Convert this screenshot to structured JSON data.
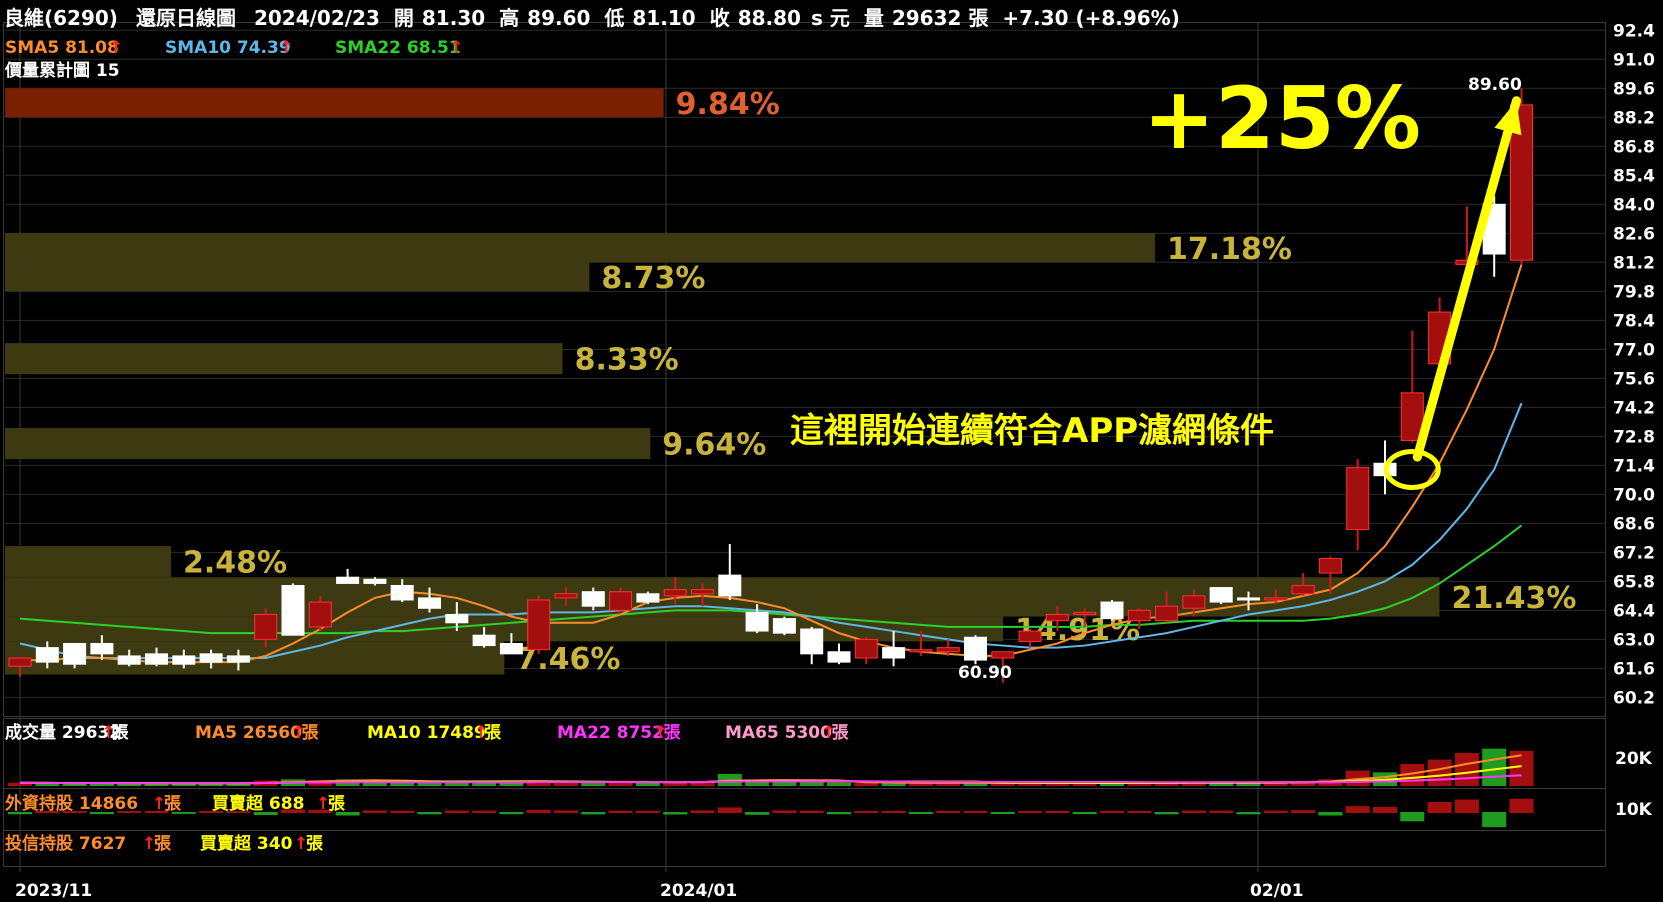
{
  "header": {
    "stock": "良維(6290)",
    "chart_kind": "還原日線圖",
    "date": "2024/02/23",
    "open_label": "開",
    "open": "81.30",
    "high_label": "高",
    "high": "89.60",
    "low_label": "低",
    "low": "81.10",
    "close_label": "收",
    "close": "88.80",
    "close_suffix": "s 元",
    "volume_label": "量",
    "volume": "29632 張",
    "change": "+7.30 (+8.96%)"
  },
  "ma_legend": [
    {
      "label": "SMA5 81.08",
      "color": "#ff8c2a"
    },
    {
      "label": "SMA10 74.39",
      "color": "#5fb6e8"
    },
    {
      "label": "SMA22 68.51",
      "color": "#2bd12b"
    }
  ],
  "vp_label": "價量累計圖 15",
  "annotation": {
    "big": "+25%",
    "text": "這裡開始連續符合APP濾網條件"
  },
  "high_marker": "89.60",
  "low_marker": "60.90",
  "volume_legend": [
    {
      "label": "成交量 29632",
      "color": "#ffffff",
      "unit": "張"
    },
    {
      "label": "MA5 26560",
      "color": "#ff8c2a",
      "unit": "張"
    },
    {
      "label": "MA10 17489",
      "color": "#ffff00",
      "unit": "張"
    },
    {
      "label": "MA22 8752",
      "color": "#ff33ff",
      "unit": "張"
    },
    {
      "label": "MA65 5300",
      "color": "#ff99cc",
      "unit": "張"
    }
  ],
  "volume_axis": [
    "20K",
    "10K"
  ],
  "foreign_legend": {
    "label": "外資持股 14866",
    "unit": "張",
    "label2": "買賣超 688",
    "unit2": "張"
  },
  "trust_legend": {
    "label": "投信持股 7627",
    "unit": "張",
    "label2": "買賣超 340",
    "unit2": "張"
  },
  "x_labels": [
    "2023/11",
    "2024/01",
    "02/01"
  ],
  "colors": {
    "up": "#a30f0f",
    "down": "#ffffff",
    "vp_top": "#7a2000",
    "vp": "#3d3a12",
    "grid": "#2b2b2b",
    "arrow": "#ffff00"
  },
  "chart_data": {
    "type": "candlestick",
    "y_ticks": [
      92.4,
      91.0,
      89.6,
      88.2,
      86.8,
      85.4,
      84.0,
      82.6,
      81.2,
      79.8,
      78.4,
      77.0,
      75.6,
      74.2,
      72.8,
      71.4,
      70.0,
      68.6,
      67.2,
      65.8,
      64.4,
      63.0,
      61.6,
      60.2
    ],
    "ylim": [
      59.3,
      92.8
    ],
    "candles": [
      {
        "o": 61.7,
        "h": 62.1,
        "l": 61.2,
        "c": 62.1
      },
      {
        "o": 62.6,
        "h": 62.9,
        "l": 61.6,
        "c": 61.9
      },
      {
        "o": 62.8,
        "h": 62.8,
        "l": 61.6,
        "c": 61.8
      },
      {
        "o": 62.8,
        "h": 63.2,
        "l": 62.0,
        "c": 62.3
      },
      {
        "o": 62.2,
        "h": 62.5,
        "l": 61.7,
        "c": 61.8
      },
      {
        "o": 62.3,
        "h": 62.6,
        "l": 61.7,
        "c": 61.8
      },
      {
        "o": 62.2,
        "h": 62.5,
        "l": 61.6,
        "c": 61.8
      },
      {
        "o": 62.3,
        "h": 62.5,
        "l": 61.6,
        "c": 61.9
      },
      {
        "o": 62.2,
        "h": 62.5,
        "l": 61.5,
        "c": 61.9
      },
      {
        "o": 63.0,
        "h": 64.5,
        "l": 62.6,
        "c": 64.2
      },
      {
        "o": 65.6,
        "h": 65.7,
        "l": 63.2,
        "c": 63.2
      },
      {
        "o": 63.6,
        "h": 65.1,
        "l": 63.4,
        "c": 64.8
      },
      {
        "o": 66.0,
        "h": 66.4,
        "l": 65.7,
        "c": 65.7
      },
      {
        "o": 65.9,
        "h": 66.0,
        "l": 65.6,
        "c": 65.7
      },
      {
        "o": 65.6,
        "h": 65.9,
        "l": 64.8,
        "c": 64.9
      },
      {
        "o": 65.0,
        "h": 65.5,
        "l": 64.3,
        "c": 64.5
      },
      {
        "o": 64.2,
        "h": 64.8,
        "l": 63.4,
        "c": 63.8
      },
      {
        "o": 63.2,
        "h": 63.6,
        "l": 62.6,
        "c": 62.7
      },
      {
        "o": 62.8,
        "h": 63.3,
        "l": 62.3,
        "c": 62.3
      },
      {
        "o": 62.5,
        "h": 65.1,
        "l": 62.3,
        "c": 64.9
      },
      {
        "o": 65.0,
        "h": 65.5,
        "l": 64.6,
        "c": 65.2
      },
      {
        "o": 65.3,
        "h": 65.5,
        "l": 64.4,
        "c": 64.6
      },
      {
        "o": 64.4,
        "h": 65.5,
        "l": 64.3,
        "c": 65.3
      },
      {
        "o": 65.2,
        "h": 65.3,
        "l": 64.7,
        "c": 64.8
      },
      {
        "o": 65.1,
        "h": 66.0,
        "l": 64.7,
        "c": 65.4
      },
      {
        "o": 65.2,
        "h": 65.7,
        "l": 64.6,
        "c": 65.4
      },
      {
        "o": 66.1,
        "h": 67.6,
        "l": 64.9,
        "c": 65.1
      },
      {
        "o": 64.3,
        "h": 64.7,
        "l": 63.3,
        "c": 63.4
      },
      {
        "o": 64.0,
        "h": 64.1,
        "l": 63.2,
        "c": 63.3
      },
      {
        "o": 63.5,
        "h": 63.6,
        "l": 61.8,
        "c": 62.3
      },
      {
        "o": 62.4,
        "h": 62.8,
        "l": 61.8,
        "c": 61.9
      },
      {
        "o": 62.1,
        "h": 63.1,
        "l": 61.8,
        "c": 63.0
      },
      {
        "o": 62.6,
        "h": 63.4,
        "l": 61.7,
        "c": 62.1
      },
      {
        "o": 62.4,
        "h": 63.4,
        "l": 62.2,
        "c": 62.5
      },
      {
        "o": 62.4,
        "h": 63.0,
        "l": 62.2,
        "c": 62.6
      },
      {
        "o": 63.1,
        "h": 63.2,
        "l": 61.8,
        "c": 62.0
      },
      {
        "o": 62.1,
        "h": 62.4,
        "l": 60.9,
        "c": 62.4
      },
      {
        "o": 62.9,
        "h": 63.5,
        "l": 62.6,
        "c": 63.4
      },
      {
        "o": 63.9,
        "h": 64.6,
        "l": 63.4,
        "c": 64.2
      },
      {
        "o": 64.3,
        "h": 64.5,
        "l": 63.6,
        "c": 64.3
      },
      {
        "o": 64.8,
        "h": 64.9,
        "l": 63.9,
        "c": 64.0
      },
      {
        "o": 63.9,
        "h": 64.5,
        "l": 63.5,
        "c": 64.4
      },
      {
        "o": 63.9,
        "h": 65.3,
        "l": 63.8,
        "c": 64.6
      },
      {
        "o": 64.5,
        "h": 65.4,
        "l": 64.1,
        "c": 65.1
      },
      {
        "o": 65.5,
        "h": 65.5,
        "l": 64.7,
        "c": 64.8
      },
      {
        "o": 65.0,
        "h": 65.3,
        "l": 64.4,
        "c": 64.9
      },
      {
        "o": 65.0,
        "h": 65.4,
        "l": 64.7,
        "c": 65.0
      },
      {
        "o": 65.2,
        "h": 66.2,
        "l": 65.1,
        "c": 65.6
      },
      {
        "o": 66.2,
        "h": 67.0,
        "l": 65.2,
        "c": 66.9
      },
      {
        "o": 68.3,
        "h": 71.7,
        "l": 67.3,
        "c": 71.3
      },
      {
        "o": 71.5,
        "h": 72.6,
        "l": 70.0,
        "c": 70.9
      },
      {
        "o": 72.6,
        "h": 77.9,
        "l": 72.5,
        "c": 74.9
      },
      {
        "o": 76.3,
        "h": 79.5,
        "l": 75.7,
        "c": 78.8
      },
      {
        "o": 81.1,
        "h": 83.9,
        "l": 80.8,
        "c": 81.3
      },
      {
        "o": 84.0,
        "h": 84.4,
        "l": 80.5,
        "c": 81.6
      },
      {
        "o": 81.3,
        "h": 89.6,
        "l": 81.1,
        "c": 88.8
      }
    ],
    "sma5": [
      62.0,
      62.0,
      62.1,
      62.1,
      62.0,
      61.9,
      61.9,
      61.9,
      61.9,
      62.2,
      62.8,
      63.5,
      64.3,
      65.0,
      65.3,
      65.2,
      65.0,
      64.6,
      64.1,
      63.8,
      63.8,
      63.8,
      64.2,
      64.8,
      65.0,
      65.1,
      65.0,
      64.8,
      64.5,
      63.9,
      63.3,
      62.9,
      62.6,
      62.4,
      62.3,
      62.2,
      62.2,
      62.5,
      62.8,
      63.3,
      63.7,
      64.0,
      64.1,
      64.3,
      64.5,
      64.7,
      64.8,
      65.1,
      65.4,
      66.2,
      67.5,
      69.4,
      71.5,
      74.1,
      77.0,
      81.1
    ],
    "sma10": [
      62.8,
      62.5,
      62.2,
      62.1,
      62.1,
      62.1,
      62.1,
      62.1,
      62.1,
      62.1,
      62.4,
      62.7,
      63.1,
      63.4,
      63.7,
      64.0,
      64.2,
      64.2,
      64.2,
      64.3,
      64.3,
      64.3,
      64.4,
      64.5,
      64.6,
      64.6,
      64.5,
      64.4,
      64.3,
      64.1,
      63.8,
      63.6,
      63.4,
      63.2,
      63.0,
      62.8,
      62.7,
      62.6,
      62.6,
      62.7,
      62.9,
      63.1,
      63.3,
      63.6,
      63.9,
      64.2,
      64.4,
      64.6,
      64.9,
      65.3,
      65.8,
      66.6,
      67.8,
      69.3,
      71.2,
      74.4
    ],
    "sma22": [
      64.0,
      63.9,
      63.8,
      63.7,
      63.6,
      63.5,
      63.4,
      63.3,
      63.3,
      63.3,
      63.3,
      63.3,
      63.3,
      63.4,
      63.4,
      63.5,
      63.6,
      63.7,
      63.8,
      63.9,
      64.0,
      64.1,
      64.2,
      64.3,
      64.4,
      64.4,
      64.4,
      64.3,
      64.2,
      64.1,
      64.0,
      63.9,
      63.8,
      63.7,
      63.6,
      63.6,
      63.6,
      63.6,
      63.6,
      63.6,
      63.7,
      63.7,
      63.8,
      63.9,
      63.9,
      63.9,
      63.9,
      63.9,
      64.0,
      64.2,
      64.5,
      65.0,
      65.7,
      66.6,
      67.5,
      68.5
    ],
    "volume_profile": [
      {
        "low": 88.2,
        "high": 89.6,
        "pct": 9.84
      },
      {
        "low": 81.2,
        "high": 82.6,
        "pct": 17.18
      },
      {
        "low": 79.8,
        "high": 81.2,
        "pct": 8.73
      },
      {
        "low": 75.8,
        "high": 77.3,
        "pct": 8.33
      },
      {
        "low": 71.7,
        "high": 73.2,
        "pct": 9.64
      },
      {
        "low": 66.0,
        "high": 67.5,
        "pct": 2.48
      },
      {
        "low": 64.1,
        "high": 66.0,
        "pct": 21.43
      },
      {
        "low": 62.9,
        "high": 64.1,
        "pct": 14.91
      },
      {
        "low": 61.3,
        "high": 62.9,
        "pct": 7.46
      }
    ],
    "volume": [
      1500,
      1300,
      1200,
      1400,
      1100,
      1200,
      1100,
      1300,
      1000,
      2500,
      3000,
      2600,
      3000,
      2000,
      1500,
      1600,
      1800,
      1700,
      1500,
      2600,
      2000,
      1700,
      1600,
      1500,
      1800,
      1900,
      5500,
      2200,
      1900,
      1600,
      1500,
      1400,
      1400,
      1300,
      1400,
      1500,
      1300,
      1300,
      1400,
      1400,
      1500,
      1300,
      1600,
      1800,
      1700,
      1600,
      1700,
      2200,
      3000,
      7000,
      6200,
      10000,
      12000,
      15000,
      17000,
      16000
    ],
    "vol_max": 30000
  }
}
